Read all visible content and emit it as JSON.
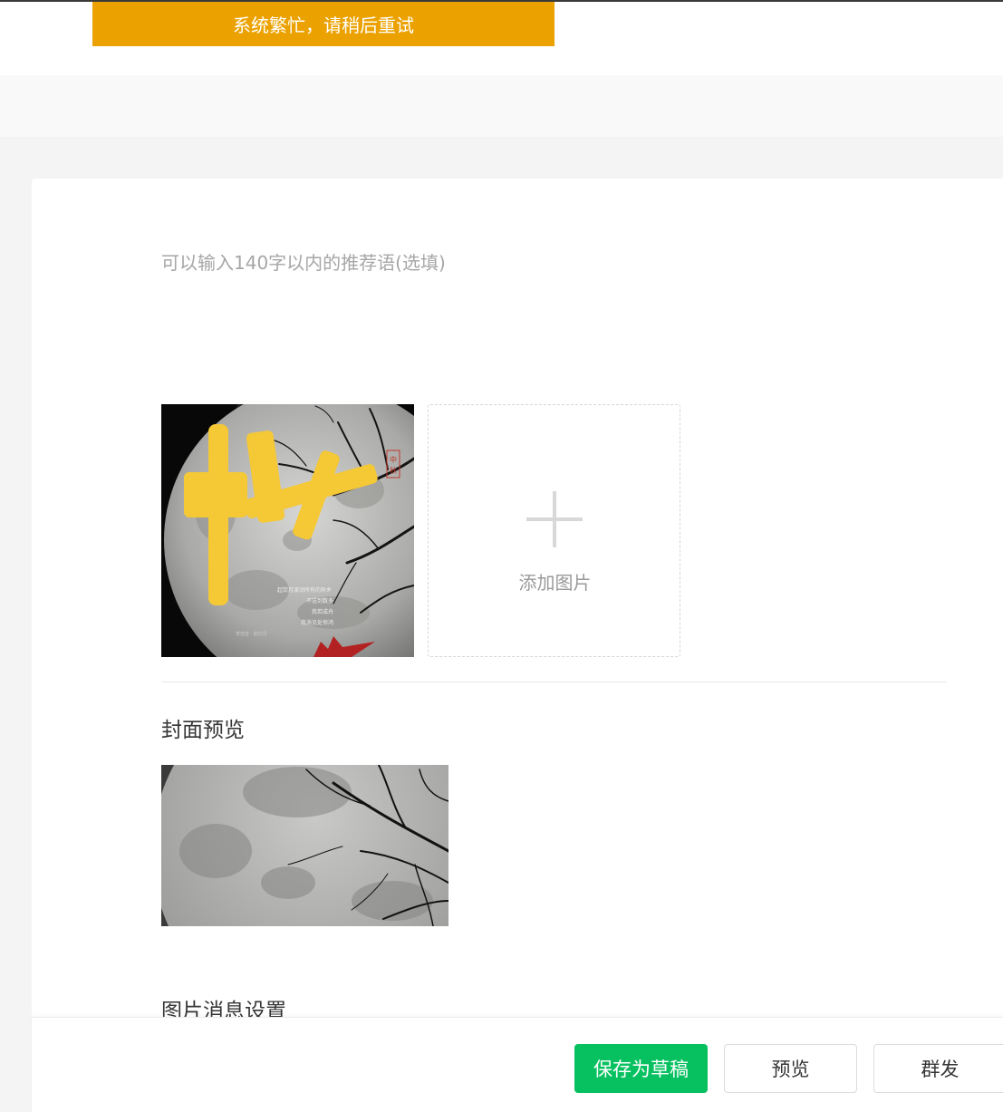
{
  "toast": {
    "message": "系统繁忙，请稍后重试"
  },
  "recommendation": {
    "placeholder": "可以输入140字以内的推荐语(选填)",
    "value": ""
  },
  "images": {
    "thumbnail": {
      "title": "中秋",
      "seal": "中秋",
      "poem_lines": [
        "起饮月波动所有的异乡",
        "不送到数多",
        "我若成舟",
        "我消见处惊鸿"
      ],
      "credit": "李佳音 · 赵饮月"
    },
    "add_label": "添加图片"
  },
  "cover_preview": {
    "title": "封面预览"
  },
  "image_message_settings": {
    "title": "图片消息设置"
  },
  "actions": {
    "save_draft": "保存为草稿",
    "preview": "预览",
    "mass_send": "群发"
  },
  "colors": {
    "toast_bg": "#eba200",
    "primary": "#07c160",
    "title_yellow": "#f5c836",
    "seal_red": "#c0392b"
  }
}
